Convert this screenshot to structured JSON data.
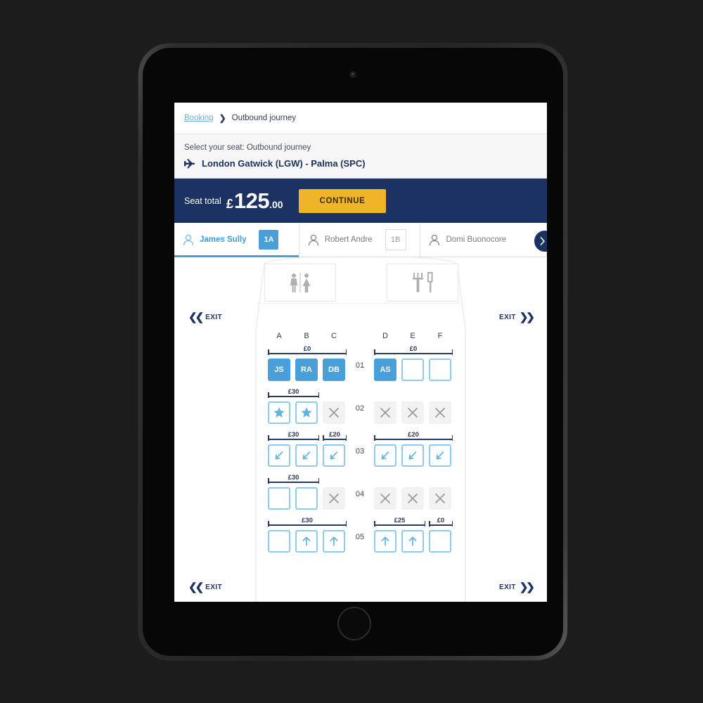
{
  "app": {
    "breadcrumb": {
      "link": "Booking",
      "separator": "❯",
      "current": "Outbound journey"
    },
    "route_header": {
      "subtitle": "Select your seat: Outbound journey",
      "route": "London Gatwick (LGW) - Palma (SPC)",
      "plane_icon": "airplane-icon"
    },
    "total_bar": {
      "label": "Seat total",
      "currency": "£",
      "amount_integer": "125",
      "amount_decimal": ".00",
      "continue_label": "CONTINUE",
      "bg_color": "#1b3263",
      "button_color": "#f0b429"
    },
    "passenger_tabs": {
      "next_icon": "chevron-right-icon",
      "items": [
        {
          "name": "James Sully",
          "seat": "1A",
          "selected": true,
          "icon": "person-icon"
        },
        {
          "name": "Robert Andre",
          "seat": "1B",
          "selected": false,
          "icon": "person-icon"
        },
        {
          "name": "Domi Buonocore",
          "seat": "",
          "selected": false,
          "icon": "person-icon"
        }
      ]
    },
    "seatmap": {
      "facilities": [
        {
          "name": "lavatory",
          "icon": "lavatory-icon"
        },
        {
          "name": "galley",
          "icon": "galley-icon"
        }
      ],
      "exit_label": "EXIT",
      "column_labels": [
        "A",
        "B",
        "C",
        "D",
        "E",
        "F"
      ],
      "rows": [
        {
          "number": "01",
          "left_bracket": "£0",
          "right_bracket": "£0",
          "seats": [
            {
              "col": "A",
              "state": "occupied",
              "label": "JS",
              "icon": ""
            },
            {
              "col": "B",
              "state": "occupied",
              "label": "RA",
              "icon": ""
            },
            {
              "col": "C",
              "state": "occupied",
              "label": "DB",
              "icon": ""
            },
            {
              "col": "D",
              "state": "occupied",
              "label": "AS",
              "icon": ""
            },
            {
              "col": "E",
              "state": "free",
              "label": "",
              "icon": ""
            },
            {
              "col": "F",
              "state": "free",
              "label": "",
              "icon": ""
            }
          ]
        },
        {
          "number": "02",
          "left_bracket": "£30",
          "right_bracket": "",
          "seats": [
            {
              "col": "A",
              "state": "free",
              "label": "",
              "icon": "star-icon"
            },
            {
              "col": "B",
              "state": "free",
              "label": "",
              "icon": "star-icon"
            },
            {
              "col": "C",
              "state": "blocked",
              "label": "",
              "icon": "cross-icon"
            },
            {
              "col": "D",
              "state": "blocked",
              "label": "",
              "icon": "cross-icon"
            },
            {
              "col": "E",
              "state": "blocked",
              "label": "",
              "icon": "cross-icon"
            },
            {
              "col": "F",
              "state": "blocked",
              "label": "",
              "icon": "cross-icon"
            }
          ]
        },
        {
          "number": "03",
          "left_bracket": "£30",
          "left_bracket2": "£20",
          "right_bracket": "£20",
          "seats": [
            {
              "col": "A",
              "state": "free",
              "label": "",
              "icon": "legroom-icon"
            },
            {
              "col": "B",
              "state": "free",
              "label": "",
              "icon": "legroom-icon"
            },
            {
              "col": "C",
              "state": "free",
              "label": "",
              "icon": "legroom-icon"
            },
            {
              "col": "D",
              "state": "free",
              "label": "",
              "icon": "legroom-icon"
            },
            {
              "col": "E",
              "state": "free",
              "label": "",
              "icon": "legroom-icon"
            },
            {
              "col": "F",
              "state": "free",
              "label": "",
              "icon": "legroom-icon"
            }
          ]
        },
        {
          "number": "04",
          "left_bracket": "£30",
          "right_bracket": "",
          "seats": [
            {
              "col": "A",
              "state": "free",
              "label": "",
              "icon": ""
            },
            {
              "col": "B",
              "state": "free",
              "label": "",
              "icon": ""
            },
            {
              "col": "C",
              "state": "blocked",
              "label": "",
              "icon": "cross-icon"
            },
            {
              "col": "D",
              "state": "blocked",
              "label": "",
              "icon": "cross-icon"
            },
            {
              "col": "E",
              "state": "blocked",
              "label": "",
              "icon": "cross-icon"
            },
            {
              "col": "F",
              "state": "blocked",
              "label": "",
              "icon": "cross-icon"
            }
          ]
        },
        {
          "number": "05",
          "left_bracket": "£30",
          "right_bracket": "£25",
          "right_bracket2": "£0",
          "seats": [
            {
              "col": "A",
              "state": "free",
              "label": "",
              "icon": ""
            },
            {
              "col": "B",
              "state": "free",
              "label": "",
              "icon": "front-icon"
            },
            {
              "col": "C",
              "state": "free",
              "label": "",
              "icon": "front-icon"
            },
            {
              "col": "D",
              "state": "free",
              "label": "",
              "icon": "front-icon"
            },
            {
              "col": "E",
              "state": "free",
              "label": "",
              "icon": "front-icon"
            },
            {
              "col": "F",
              "state": "free",
              "label": "",
              "icon": ""
            }
          ]
        }
      ]
    }
  }
}
